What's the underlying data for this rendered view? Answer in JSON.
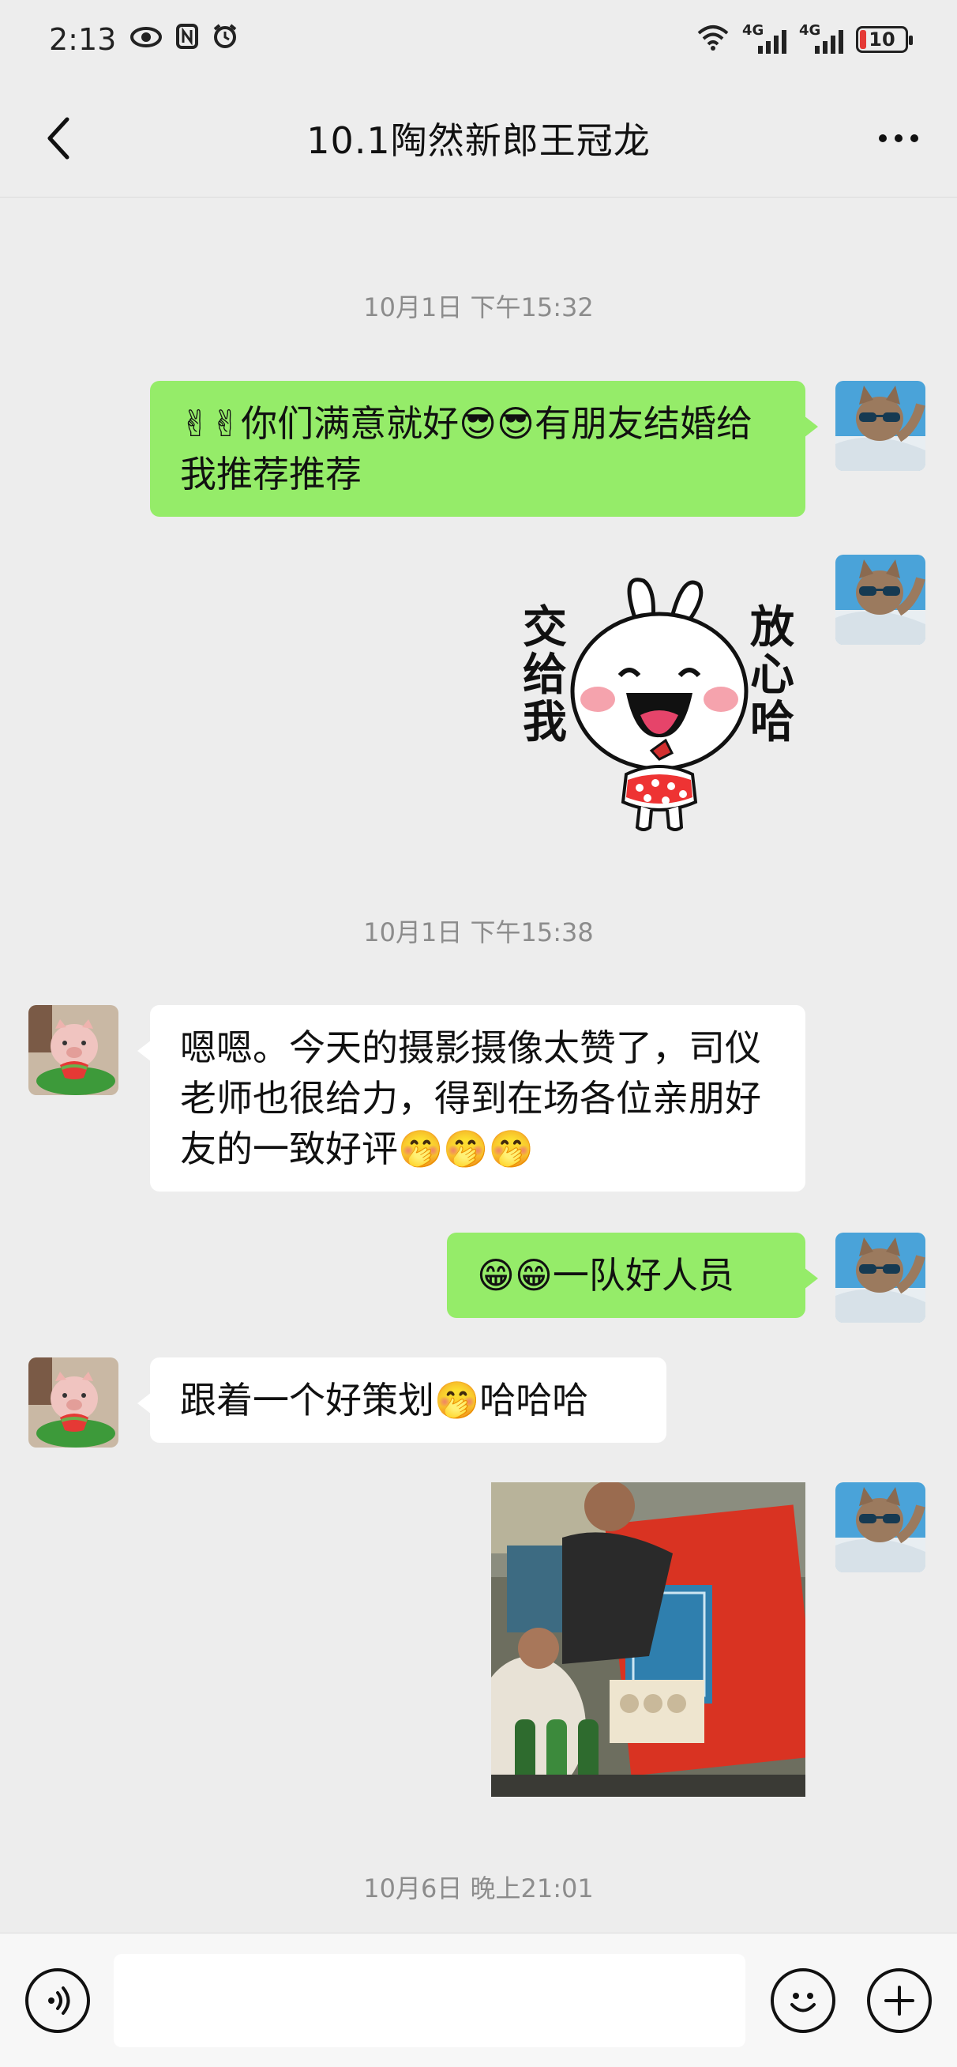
{
  "status_bar": {
    "time": "2:13",
    "signal_label": "4G",
    "battery_level": "10",
    "icons": [
      "eye-icon",
      "nfc-icon",
      "alarm-icon",
      "wifi-icon",
      "signal-icon",
      "battery-icon"
    ]
  },
  "header": {
    "title": "10.1陶然新郎王冠龙",
    "back_icon": "chevron-left-icon",
    "more_icon": "more-dots-icon"
  },
  "messages": {
    "ts1": "10月1日 下午15:32",
    "m1": "✌✌你们满意就好😎😎有朋友结婚给我推荐推荐",
    "sticker": {
      "left_text": "交给我",
      "right_text": "放心哈"
    },
    "ts2": "10月1日 下午15:38",
    "m2": "嗯嗯。今天的摄影摄像太赞了，司仪老师也很给力，得到在场各位亲朋好友的一致好评🤭🤭🤭",
    "m3": "😁😁一队好人员",
    "m4": "跟着一个好策划🤭哈哈哈",
    "ts3": "10月6日 晚上21:01"
  },
  "input_bar": {
    "voice_icon": "voice-icon",
    "emoji_icon": "emoji-icon",
    "plus_icon": "plus-icon",
    "input_value": ""
  },
  "colors": {
    "my_bubble": "#95ec69",
    "their_bubble": "#ffffff",
    "background": "#ededed"
  }
}
